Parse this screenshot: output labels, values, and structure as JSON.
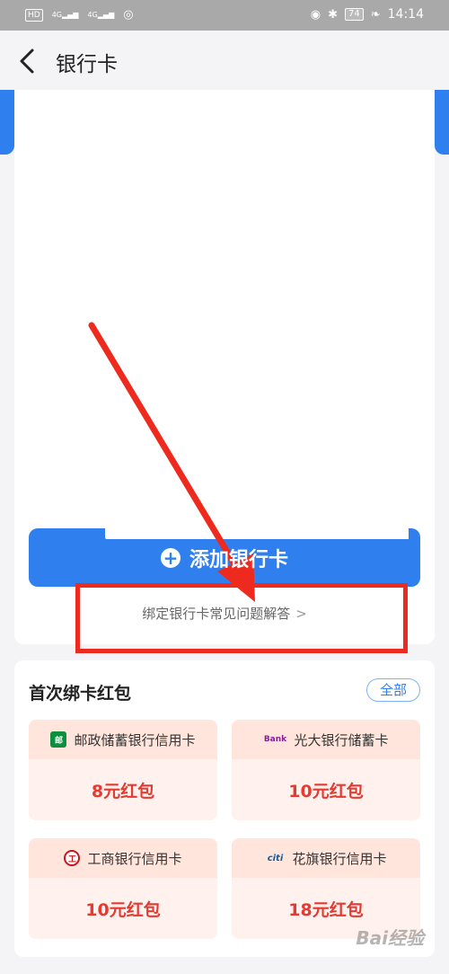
{
  "status_bar": {
    "hd": "HD",
    "signal1": "4G",
    "signal2": "4G",
    "battery": "74",
    "time": "14:14"
  },
  "header": {
    "title": "银行卡"
  },
  "cards": {
    "add_label": "添加银行卡",
    "faq_link": "绑定银行卡常见问题解答",
    "faq_chevron": ">"
  },
  "packets": {
    "title": "首次绑卡红包",
    "all_label": "全部",
    "items": [
      {
        "bank": "邮政储蓄银行信用卡",
        "amount": "8元红包",
        "logo_text": "邮"
      },
      {
        "bank": "光大银行储蓄卡",
        "amount": "10元红包",
        "logo_text": "Bank"
      },
      {
        "bank": "工商银行信用卡",
        "amount": "10元红包",
        "logo_text": "工"
      },
      {
        "bank": "花旗银行信用卡",
        "amount": "18元红包",
        "logo_text": "citi"
      }
    ]
  },
  "watermark": "Bai经验",
  "colors": {
    "accent": "#2f80ee",
    "annotation_red": "#ee2a1f",
    "packet_amount": "#e33a32"
  }
}
